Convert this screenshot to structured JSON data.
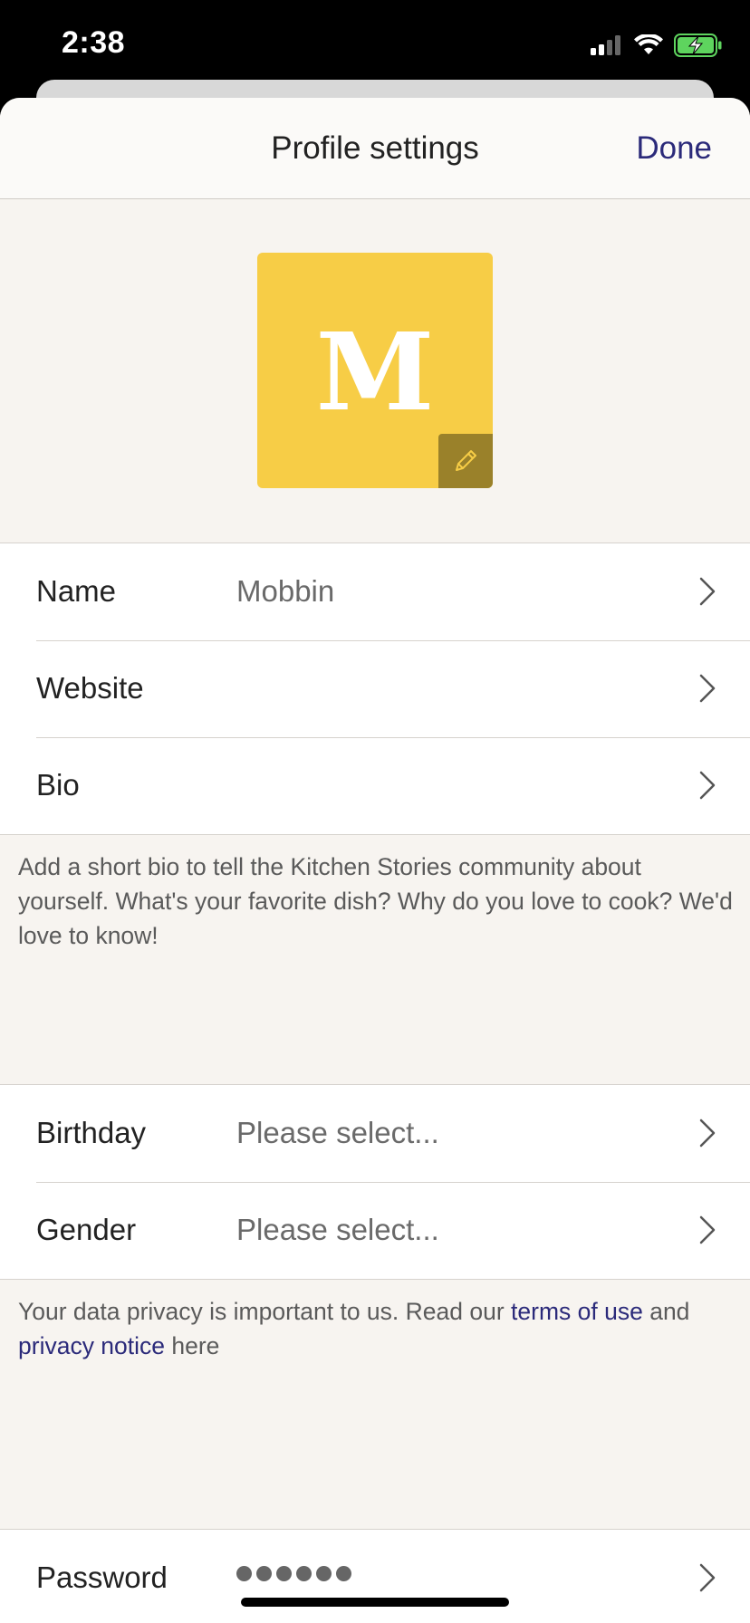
{
  "status_bar": {
    "time": "2:38",
    "icons": [
      "cellular-signal-icon",
      "wifi-icon",
      "battery-charging-icon"
    ]
  },
  "nav": {
    "title": "Profile settings",
    "done_label": "Done"
  },
  "avatar": {
    "letter": "M",
    "color": "#f7cd46",
    "edit_icon": "pencil-icon"
  },
  "profile_rows": [
    {
      "label": "Name",
      "value": "Mobbin"
    },
    {
      "label": "Website",
      "value": ""
    },
    {
      "label": "Bio",
      "value": ""
    }
  ],
  "bio_hint": "Add a short bio to tell the Kitchen Stories community about yourself. What's your favorite dish? Why do you love to cook? We'd love to know!",
  "personal_rows": [
    {
      "label": "Birthday",
      "value": "Please select..."
    },
    {
      "label": "Gender",
      "value": "Please select..."
    }
  ],
  "privacy": {
    "text_before": "Your data privacy is important to us. Read our ",
    "terms_link": "terms of use",
    "text_middle": " and ",
    "privacy_link": "privacy notice",
    "text_after": " here"
  },
  "password_row": {
    "label": "Password",
    "masked_length": 6
  },
  "colors": {
    "accent": "#2b2a7a",
    "background": "#f7f4f0",
    "avatar_edit": "#9a812a"
  }
}
